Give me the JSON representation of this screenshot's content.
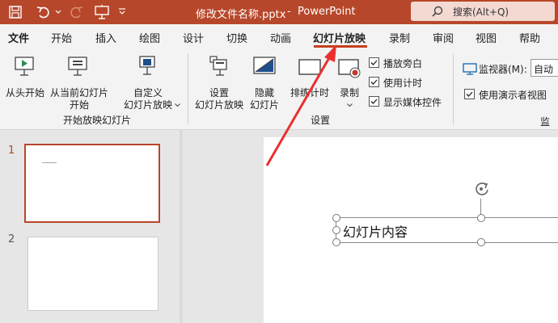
{
  "titlebar": {
    "doc_title": "修改文件名称.pptx",
    "separator": "-",
    "app_name": "PowerPoint",
    "search_placeholder": "搜索(Alt+Q)"
  },
  "menu": {
    "items": [
      "文件",
      "开始",
      "插入",
      "绘图",
      "设计",
      "切换",
      "动画",
      "幻灯片放映",
      "录制",
      "审阅",
      "视图",
      "帮助"
    ],
    "active": "幻灯片放映"
  },
  "ribbon": {
    "start_group": {
      "from_beginning": "从头开始",
      "from_current_1": "从当前幻灯片",
      "from_current_2": "开始",
      "custom_1": "自定义",
      "custom_2": "幻灯片放映",
      "group_label": "开始放映幻灯片"
    },
    "setup_group": {
      "setup_1": "设置",
      "setup_2": "幻灯片放映",
      "hide_1": "隐藏",
      "hide_2": "幻灯片",
      "rehearse": "排练计时",
      "record": "录制",
      "cb_narration": "播放旁白",
      "cb_timing": "使用计时",
      "cb_media": "显示媒体控件",
      "group_label": "设置"
    },
    "monitor_group": {
      "monitor_label": "监视器(M):",
      "monitor_value": "自动",
      "presenter_view": "使用演示者视图",
      "group_label_partial": "监"
    }
  },
  "slides": {
    "numbers": [
      "1",
      "2"
    ]
  },
  "slide_content": {
    "textbox": "幻灯片内容"
  },
  "colors": {
    "accent": "#b7472a",
    "active_underline": "#c43e1c"
  }
}
